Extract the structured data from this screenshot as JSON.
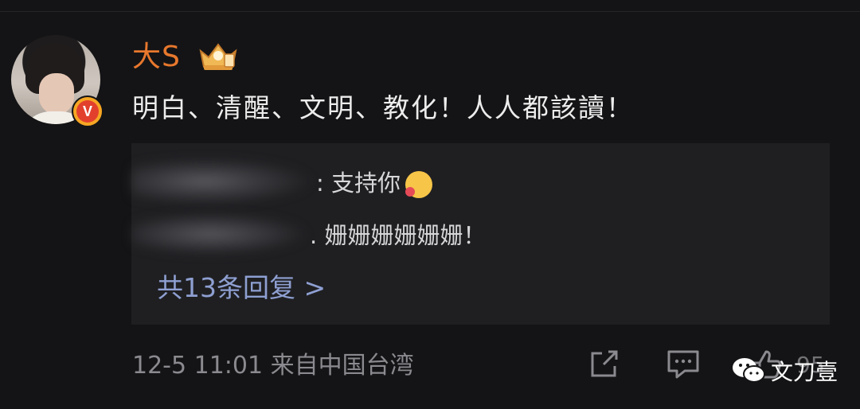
{
  "post": {
    "username": "大S",
    "verified_badge": "V",
    "comment_text": "明白、清醒、文明、教化！人人都該讀！"
  },
  "replies": [
    {
      "text": ": 支持你"
    },
    {
      "text": ". 姗姗姗姗姗姗！"
    }
  ],
  "more_replies_label": "共13条回复 >",
  "meta": {
    "timestamp": "12-5 11:01",
    "source": "来自中国台湾"
  },
  "actions": {
    "like_count": "95"
  },
  "watermark": "文刀壹",
  "colors": {
    "background": "#141416",
    "username": "#e8782d",
    "link": "#8e9fd1",
    "meta": "#8a8a8f"
  }
}
